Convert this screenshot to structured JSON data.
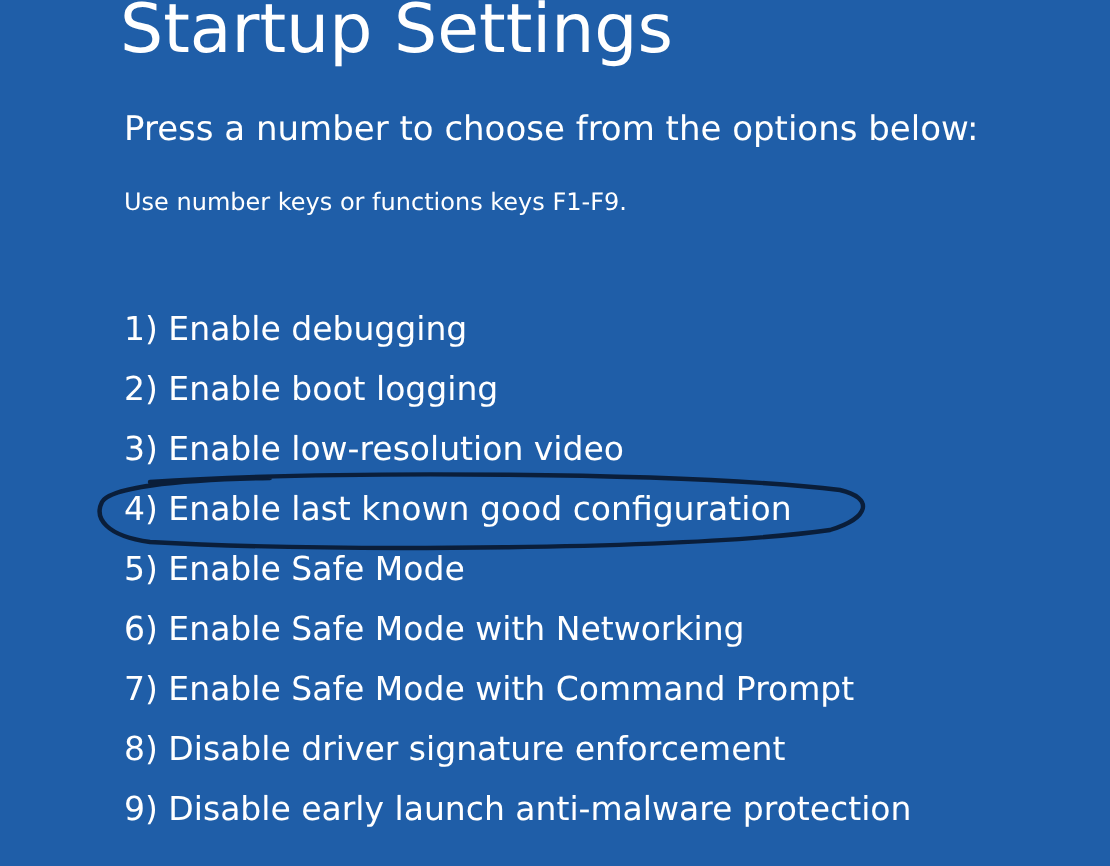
{
  "title": "Startup Settings",
  "prompt": "Press a number to choose from the options below:",
  "hint": "Use number keys or functions keys F1-F9.",
  "options": [
    {
      "label": "1) Enable debugging",
      "circled": false
    },
    {
      "label": "2) Enable boot logging",
      "circled": false
    },
    {
      "label": "3) Enable low-resolution video",
      "circled": false
    },
    {
      "label": "4) Enable last known good configuration",
      "circled": true
    },
    {
      "label": "5) Enable Safe Mode",
      "circled": false
    },
    {
      "label": "6) Enable Safe Mode with Networking",
      "circled": false
    },
    {
      "label": "7) Enable Safe Mode with Command Prompt",
      "circled": false
    },
    {
      "label": "8) Disable driver signature enforcement",
      "circled": false
    },
    {
      "label": "9) Disable early launch anti-malware protection",
      "circled": false
    }
  ]
}
